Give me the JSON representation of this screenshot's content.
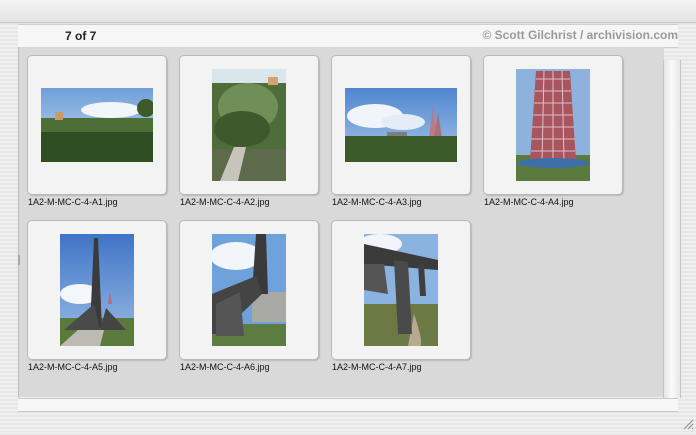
{
  "header": {
    "counter": "7 of 7",
    "copyright": "© Scott Gilchrist / archivision.com"
  },
  "thumbnails": [
    {
      "filename": "1A2-M-MC-C-4-A1.jpg"
    },
    {
      "filename": "1A2-M-MC-C-4-A2.jpg"
    },
    {
      "filename": "1A2-M-MC-C-4-A3.jpg"
    },
    {
      "filename": "1A2-M-MC-C-4-A4.jpg"
    },
    {
      "filename": "1A2-M-MC-C-4-A5.jpg"
    },
    {
      "filename": "1A2-M-MC-C-4-A6.jpg"
    },
    {
      "filename": "1A2-M-MC-C-4-A7.jpg"
    }
  ]
}
